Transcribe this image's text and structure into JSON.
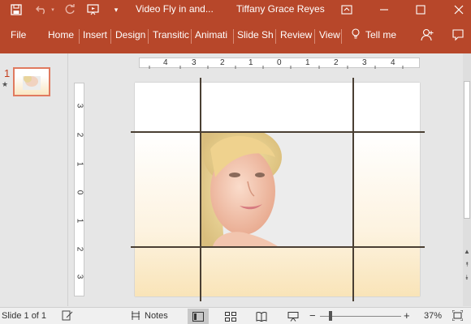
{
  "titlebar": {
    "doc_title": "Video Fly in and...",
    "user_name": "Tiffany Grace Reyes",
    "icons": [
      "save-icon",
      "undo-icon",
      "redo-icon",
      "start-from-beginning-icon",
      "customize-qat-icon",
      "ribbon-display-icon",
      "minimize-icon",
      "maximize-icon",
      "close-icon"
    ]
  },
  "ribbon": {
    "tabs": [
      "File",
      "Home",
      "Insert",
      "Design",
      "Transitic",
      "Animati",
      "Slide Sh",
      "Review",
      "View"
    ],
    "tell_me": "Tell me",
    "color": "#b7472a"
  },
  "thumbnails": {
    "slide_number": "1",
    "star": "★"
  },
  "ruler": {
    "horizontal": [
      "4",
      "3",
      "2",
      "1",
      "0",
      "1",
      "2",
      "3",
      "4"
    ],
    "vertical": [
      "3",
      "2",
      "1",
      "0",
      "1",
      "2",
      "3"
    ]
  },
  "status": {
    "slide_info": "Slide 1 of 1",
    "notes": "Notes",
    "zoom_minus": "−",
    "zoom_plus": "+",
    "zoom_level": "37%"
  }
}
